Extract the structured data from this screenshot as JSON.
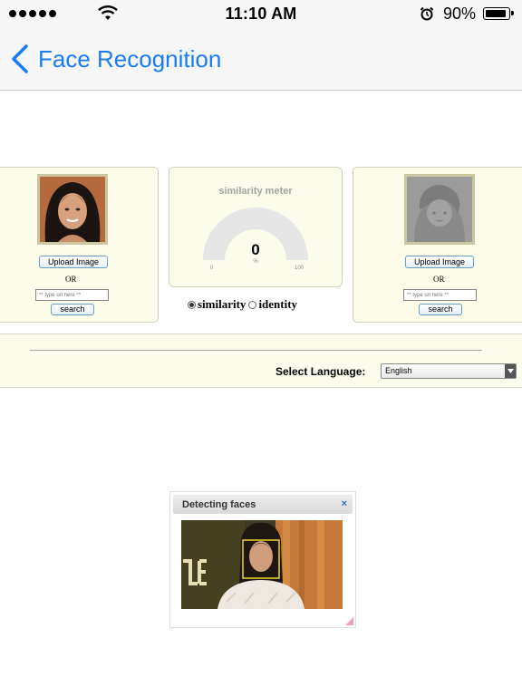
{
  "status_bar": {
    "time": "11:10 AM",
    "battery_percent": "90%"
  },
  "nav": {
    "title": "Face Recognition"
  },
  "left_panel": {
    "upload_label": "Upload Image",
    "or_label": "OR",
    "url_placeholder": "** type url here **",
    "search_label": "search"
  },
  "right_panel": {
    "upload_label": "Upload Image",
    "or_label": "OR",
    "url_placeholder": "** type url here **",
    "search_label": "search"
  },
  "meter": {
    "title": "similarity meter",
    "value": "0",
    "unit": "%",
    "min": "0",
    "max": "100"
  },
  "mode": {
    "options": [
      "similarity",
      "identity"
    ],
    "selected": "similarity"
  },
  "language": {
    "label": "Select Language:",
    "selected": "English"
  },
  "dialog": {
    "title": "Detecting faces",
    "close": "×"
  },
  "colors": {
    "accent": "#1a7cf5",
    "panel_bg": "#fcfce8"
  }
}
